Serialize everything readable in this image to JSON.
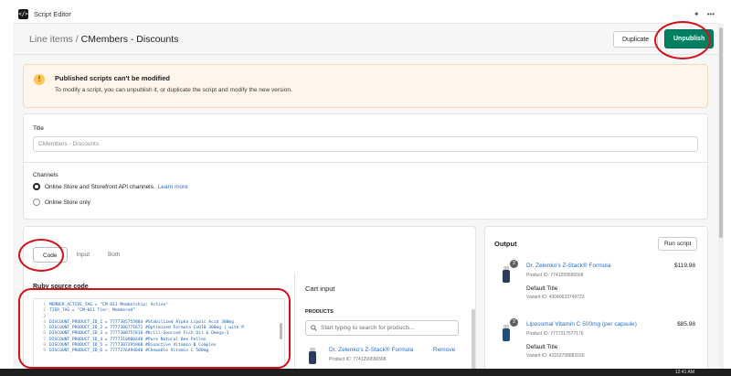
{
  "window": {
    "title": "Script Editor"
  },
  "header": {
    "breadcrumb_parent": "Line items",
    "breadcrumb_sep": "/",
    "breadcrumb_current": "CMembers - Discounts",
    "duplicate_label": "Duplicate",
    "unpublish_label": "Unpublish"
  },
  "banner": {
    "title": "Published scripts can't be modified",
    "text": "To modify a script, you can unpublish it, or duplicate the script and modify the new version."
  },
  "title_section": {
    "label": "Title",
    "value": "CMembers - Discounts"
  },
  "channels": {
    "label": "Channels",
    "option1": "Online Store and Storefront API channels.",
    "option1_link": "Learn more",
    "option2": "Online Store only"
  },
  "editor_tabs": [
    "Code",
    "Input",
    "Both"
  ],
  "source": {
    "label": "Ruby source code",
    "lines": [
      {
        "n": "1",
        "code": "MEMBER_ACTIVE_TAG = \"CM-011 Membership: Active\""
      },
      {
        "n": "2",
        "code": "TIER_TAG = \"CM-011 Tier: Membered\""
      },
      {
        "n": "3",
        "code": ""
      },
      {
        "n": "4",
        "code": "DISCOUNT_PRODUCT_ID_1 = 7777305755884 #Stabilized Alpha Lipoic Acid 300mg"
      },
      {
        "n": "5",
        "code": "DISCOUNT_PRODUCT_ID_2 = 7777306771672 #Optimized Formula CoQ10 300mg | with P"
      },
      {
        "n": "6",
        "code": "DISCOUNT_PRODUCT_ID_3 = 7777308757816 #Krill-Sourced Fish Oil & Omega-3"
      },
      {
        "n": "7",
        "code": "DISCOUNT_PRODUCT_ID_4 = 7777310980440 #Pure Natural Bee Pollen"
      },
      {
        "n": "8",
        "code": "DISCOUNT_PRODUCT_ID_5 = 7777307295960 #Bioactive Vitamin B Complex"
      },
      {
        "n": "9",
        "code": "DISCOUNT_PRODUCT_ID_6 = 7777276494040 #Chewable Vitamin C 500mg"
      }
    ]
  },
  "cart_input": {
    "title": "Cart input",
    "products_label": "PRODUCTS",
    "search_placeholder": "Start typing to search for products...",
    "item_name": "Dr. Zelenko's Z-Stack® Formula",
    "item_id": "Product ID: 7741299556568",
    "remove_label": "Remove"
  },
  "output": {
    "title": "Output",
    "run_label": "Run script",
    "items": [
      {
        "qty": "2",
        "name": "Dr. Zelenko's Z-Stack® Formula",
        "product_id": "Product ID: 7741299556568",
        "price": "$119.98",
        "variant_title": "Default Title",
        "variant_id": "Variant ID: 43040633749723"
      },
      {
        "qty": "2",
        "name": "Liposomal Vitamin C 500mg (per capsule)",
        "product_id": "Product ID: 7777217577176",
        "price": "$85.98",
        "variant_title": "Default Title",
        "variant_id": "Variant ID: 43163708883160"
      }
    ]
  },
  "taskbar": {
    "clock": "12:41 AM"
  },
  "colors": {
    "primary": "#008060",
    "link": "#2c6ecb",
    "annotation": "#d0121b",
    "banner_bg": "#fff5ea"
  }
}
